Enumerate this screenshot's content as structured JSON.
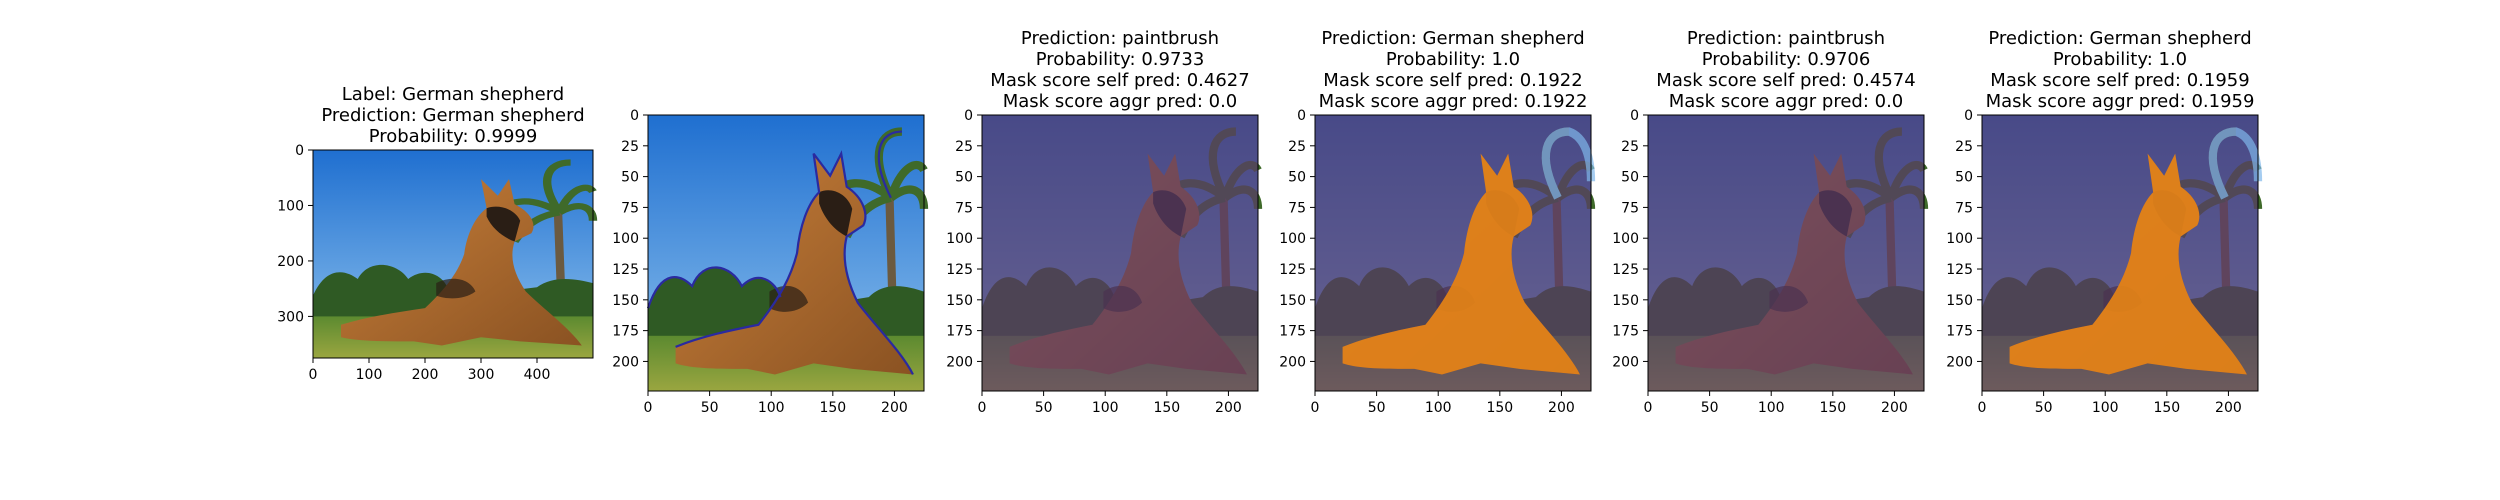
{
  "panels": [
    {
      "id": "original",
      "title_lines": [
        "Label: German shepherd",
        "Prediction: German shepherd",
        "Probability: 0.9999"
      ],
      "x_ticks": [
        "0",
        "100",
        "200",
        "300",
        "400"
      ],
      "y_ticks": [
        "0",
        "100",
        "200",
        "300"
      ],
      "image": "original-photo",
      "overlay": "none"
    },
    {
      "id": "contour",
      "title_lines": [],
      "x_ticks": [
        "0",
        "50",
        "100",
        "150",
        "200"
      ],
      "y_ticks": [
        "0",
        "25",
        "50",
        "75",
        "100",
        "125",
        "150",
        "175",
        "200"
      ],
      "image": "resized-photo-with-contour",
      "overlay": "contour"
    },
    {
      "id": "mask-1",
      "title_lines": [
        "Prediction: paintbrush",
        "Probability: 0.9733",
        "Mask score self pred: 0.4627",
        "Mask score aggr pred: 0.0"
      ],
      "x_ticks": [
        "0",
        "50",
        "100",
        "150",
        "200"
      ],
      "y_ticks": [
        "0",
        "25",
        "50",
        "75",
        "100",
        "125",
        "150",
        "175",
        "200"
      ],
      "image": "resized-photo",
      "overlay": "purple-full"
    },
    {
      "id": "mask-2",
      "title_lines": [
        "Prediction: German shepherd",
        "Probability: 1.0",
        "Mask score self pred: 0.1922",
        "Mask score aggr pred: 0.1922"
      ],
      "x_ticks": [
        "0",
        "50",
        "100",
        "150",
        "200"
      ],
      "y_ticks": [
        "0",
        "25",
        "50",
        "75",
        "100",
        "125",
        "150",
        "175",
        "200"
      ],
      "image": "resized-photo",
      "overlay": "orange-dog"
    },
    {
      "id": "mask-3",
      "title_lines": [
        "Prediction: paintbrush",
        "Probability: 0.9706",
        "Mask score self pred: 0.4574",
        "Mask score aggr pred: 0.0"
      ],
      "x_ticks": [
        "0",
        "50",
        "100",
        "150",
        "200"
      ],
      "y_ticks": [
        "0",
        "25",
        "50",
        "75",
        "100",
        "125",
        "150",
        "175",
        "200"
      ],
      "image": "resized-photo",
      "overlay": "purple-full"
    },
    {
      "id": "mask-4",
      "title_lines": [
        "Prediction: German shepherd",
        "Probability: 1.0",
        "Mask score self pred: 0.1959",
        "Mask score aggr pred: 0.1959"
      ],
      "x_ticks": [
        "0",
        "50",
        "100",
        "150",
        "200"
      ],
      "y_ticks": [
        "0",
        "25",
        "50",
        "75",
        "100",
        "125",
        "150",
        "175",
        "200"
      ],
      "image": "resized-photo",
      "overlay": "orange-dog"
    }
  ],
  "colors": {
    "sky": "#2f7fd6",
    "sky_light": "#7fb7ea",
    "grass": "#4f7a2c",
    "trees": "#2f5a24",
    "dog": "#b06a2c",
    "dog_dark": "#2a1e15",
    "purple_overlay": "#5a3a6a",
    "orange_overlay": "#f08a10",
    "contour": "#2a2aa0"
  }
}
